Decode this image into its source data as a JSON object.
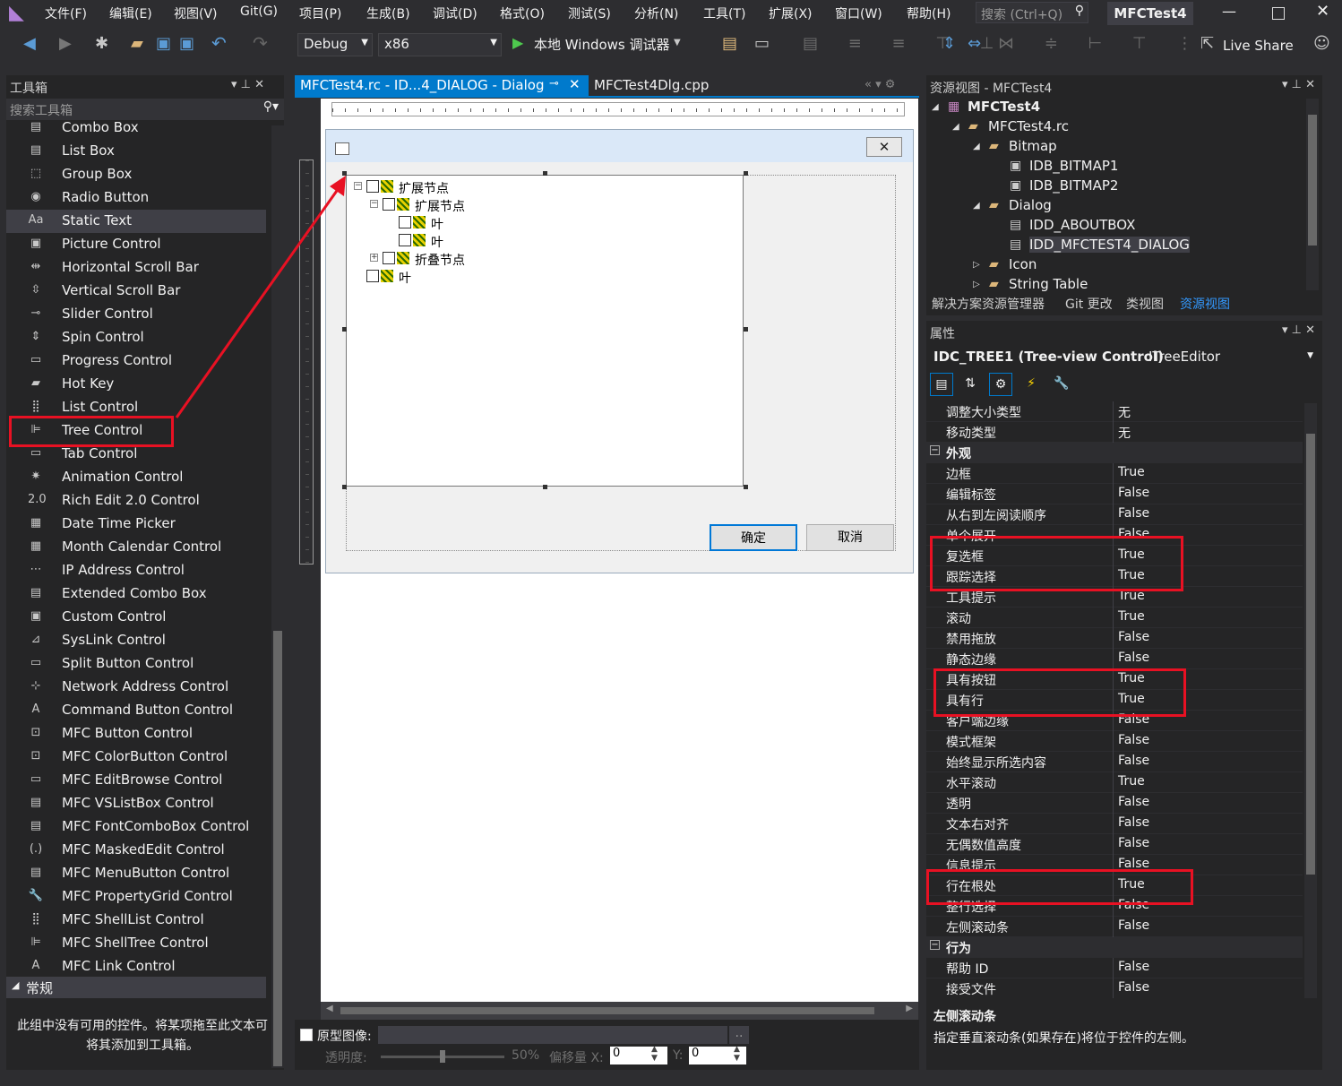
{
  "menu": {
    "items": [
      "文件(F)",
      "编辑(E)",
      "视图(V)",
      "Git(G)",
      "项目(P)",
      "生成(B)",
      "调试(D)",
      "格式(O)",
      "测试(S)",
      "分析(N)",
      "工具(T)",
      "扩展(X)",
      "窗口(W)",
      "帮助(H)"
    ],
    "search_placeholder": "搜索 (Ctrl+Q)",
    "project_title": "MFCTest4"
  },
  "toolbar": {
    "config": "Debug",
    "platform": "x86",
    "run_label": "本地 Windows 调试器",
    "live_share": "Live Share"
  },
  "toolbox": {
    "title": "工具箱",
    "search_placeholder": "搜索工具箱",
    "items": [
      "Combo Box",
      "List Box",
      "Group Box",
      "Radio Button",
      "Static Text",
      "Picture Control",
      "Horizontal Scroll Bar",
      "Vertical Scroll Bar",
      "Slider Control",
      "Spin Control",
      "Progress Control",
      "Hot Key",
      "List Control",
      "Tree Control",
      "Tab Control",
      "Animation Control",
      "Rich Edit 2.0 Control",
      "Date Time Picker",
      "Month Calendar Control",
      "IP Address Control",
      "Extended Combo Box",
      "Custom Control",
      "SysLink Control",
      "Split Button Control",
      "Network Address Control",
      "Command Button Control",
      "MFC Button Control",
      "MFC ColorButton Control",
      "MFC EditBrowse Control",
      "MFC VSListBox Control",
      "MFC FontComboBox Control",
      "MFC MaskedEdit Control",
      "MFC MenuButton Control",
      "MFC PropertyGrid Control",
      "MFC ShellList Control",
      "MFC ShellTree Control",
      "MFC Link Control"
    ],
    "group_label": "常规",
    "empty_message": "此组中没有可用的控件。将某项拖至此文本可将其添加到工具箱。"
  },
  "editor": {
    "tab_active": "MFCTest4.rc - ID...4_DIALOG - Dialog",
    "tab_other": "MFCTest4Dlg.cpp",
    "tree_nodes": [
      "扩展节点",
      "扩展节点",
      "叶",
      "叶",
      "折叠节点",
      "叶"
    ],
    "ok_button": "确定",
    "cancel_button": "取消",
    "proto_label": "原型图像:",
    "opacity_label": "透明度:",
    "opacity_value": "50%",
    "offset_x_label": "偏移量 X:",
    "offset_x_value": "0",
    "offset_y_label": "Y:",
    "offset_y_value": "0"
  },
  "resview": {
    "title": "资源视图 - MFCTest4",
    "root": "MFCTest4",
    "rc": "MFCTest4.rc",
    "bitmap": "Bitmap",
    "bmp1": "IDB_BITMAP1",
    "bmp2": "IDB_BITMAP2",
    "dialog": "Dialog",
    "dlg1": "IDD_ABOUTBOX",
    "dlg2": "IDD_MFCTEST4_DIALOG",
    "icon": "Icon",
    "stringtable": "String Table",
    "tabs": [
      "解决方案资源管理器",
      "Git 更改",
      "类视图",
      "资源视图"
    ]
  },
  "props": {
    "title": "属性",
    "object": "IDC_TREE1 (Tree-view Control)",
    "editor": "ITreeEditor",
    "rows": [
      {
        "k": "调整大小类型",
        "v": "无"
      },
      {
        "k": "移动类型",
        "v": "无"
      },
      {
        "k": "外观",
        "v": "",
        "cat": true
      },
      {
        "k": "边框",
        "v": "True"
      },
      {
        "k": "编辑标签",
        "v": "False"
      },
      {
        "k": "从右到左阅读顺序",
        "v": "False"
      },
      {
        "k": "单个展开",
        "v": "False"
      },
      {
        "k": "复选框",
        "v": "True"
      },
      {
        "k": "跟踪选择",
        "v": "True"
      },
      {
        "k": "工具提示",
        "v": "True"
      },
      {
        "k": "滚动",
        "v": "True"
      },
      {
        "k": "禁用拖放",
        "v": "False"
      },
      {
        "k": "静态边缘",
        "v": "False"
      },
      {
        "k": "具有按钮",
        "v": "True"
      },
      {
        "k": "具有行",
        "v": "True"
      },
      {
        "k": "客户端边缘",
        "v": "False"
      },
      {
        "k": "模式框架",
        "v": "False"
      },
      {
        "k": "始终显示所选内容",
        "v": "False"
      },
      {
        "k": "水平滚动",
        "v": "True"
      },
      {
        "k": "透明",
        "v": "False"
      },
      {
        "k": "文本右对齐",
        "v": "False"
      },
      {
        "k": "无偶数值高度",
        "v": "False"
      },
      {
        "k": "信息提示",
        "v": "False"
      },
      {
        "k": "行在根处",
        "v": "True"
      },
      {
        "k": "整行选择",
        "v": "False"
      },
      {
        "k": "左侧滚动条",
        "v": "False"
      },
      {
        "k": "行为",
        "v": "",
        "cat": true
      },
      {
        "k": "帮助 ID",
        "v": "False"
      },
      {
        "k": "接受文件",
        "v": "False"
      }
    ],
    "desc_title": "左侧滚动条",
    "desc_text": "指定垂直滚动条(如果存在)将位于控件的左侧。"
  }
}
